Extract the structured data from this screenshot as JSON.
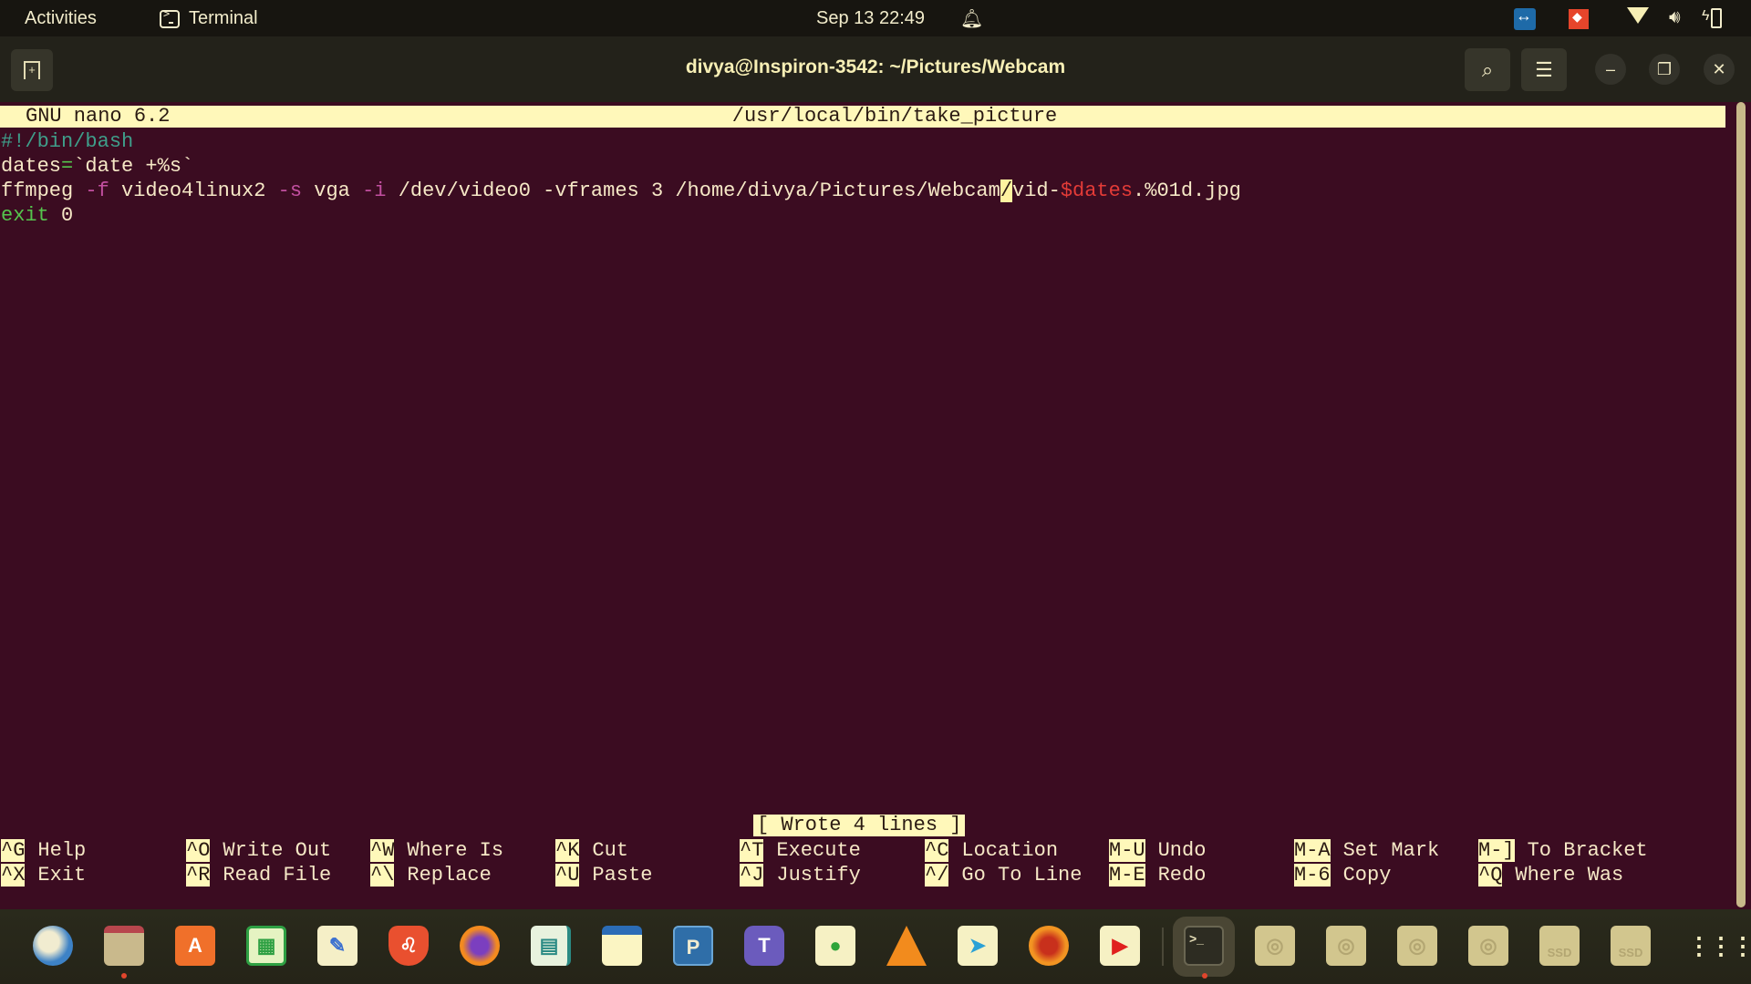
{
  "topbar": {
    "activities": "Activities",
    "app_name": "Terminal",
    "clock": "Sep 13  22:49"
  },
  "window": {
    "title": "divya@Inspiron-3542: ~/Pictures/Webcam"
  },
  "nano": {
    "version": "GNU nano 6.2",
    "filename": "/usr/local/bin/take_picture",
    "lines": {
      "l1": "#!/bin/bash",
      "l2_a": "dates",
      "l2_b": "=",
      "l2_c": "`date +%s`",
      "l3_cmd": "ffmpeg ",
      "l3_f": "-f",
      "l3_a": " video4linux2 ",
      "l3_s": "-s",
      "l3_b": " vga ",
      "l3_i": "-i",
      "l3_c": " /dev/video0 -vframes 3 /home/divya/Pictures/Webcam",
      "l3_cursor": "/",
      "l3_d": "vid-",
      "l3_var": "$dates",
      "l3_e": ".%01d.jpg",
      "l4_a": "exit",
      "l4_b": " 0"
    },
    "status": "[ Wrote 4 lines ]",
    "shortcuts": [
      {
        "key": "^G",
        "label": "Help"
      },
      {
        "key": "^X",
        "label": "Exit"
      },
      {
        "key": "^O",
        "label": "Write Out"
      },
      {
        "key": "^R",
        "label": "Read File"
      },
      {
        "key": "^W",
        "label": "Where Is"
      },
      {
        "key": "^\\",
        "label": "Replace"
      },
      {
        "key": "^K",
        "label": "Cut"
      },
      {
        "key": "^U",
        "label": "Paste"
      },
      {
        "key": "^T",
        "label": "Execute"
      },
      {
        "key": "^J",
        "label": "Justify"
      },
      {
        "key": "^C",
        "label": "Location"
      },
      {
        "key": "^/",
        "label": "Go To Line"
      },
      {
        "key": "M-U",
        "label": "Undo"
      },
      {
        "key": "M-E",
        "label": "Redo"
      },
      {
        "key": "M-A",
        "label": "Set Mark"
      },
      {
        "key": "M-6",
        "label": "Copy"
      },
      {
        "key": "M-]",
        "label": "To Bracket"
      },
      {
        "key": "^Q",
        "label": "Where Was"
      }
    ]
  },
  "dock": {
    "apps": [
      "Thunderbird",
      "Files",
      "Ubuntu Software",
      "LibreOffice Calc",
      "Text Editor",
      "Brave",
      "Firefox",
      "LibreOffice Impress",
      "Notes",
      "Remote Desktop",
      "Microsoft Teams",
      "Evernote",
      "VLC",
      "Telegram",
      "XnView",
      "YouTube",
      "Terminal",
      "Disk 1",
      "Disk 2",
      "Disk 3",
      "Disk 4",
      "SSD 1",
      "SSD 2",
      "Show Applications"
    ],
    "ssd_label": "SSD"
  },
  "colors": {
    "terminal_bg": "#3b0c21",
    "nano_highlight": "#fff8ba",
    "accent_orange": "#e0452c"
  }
}
